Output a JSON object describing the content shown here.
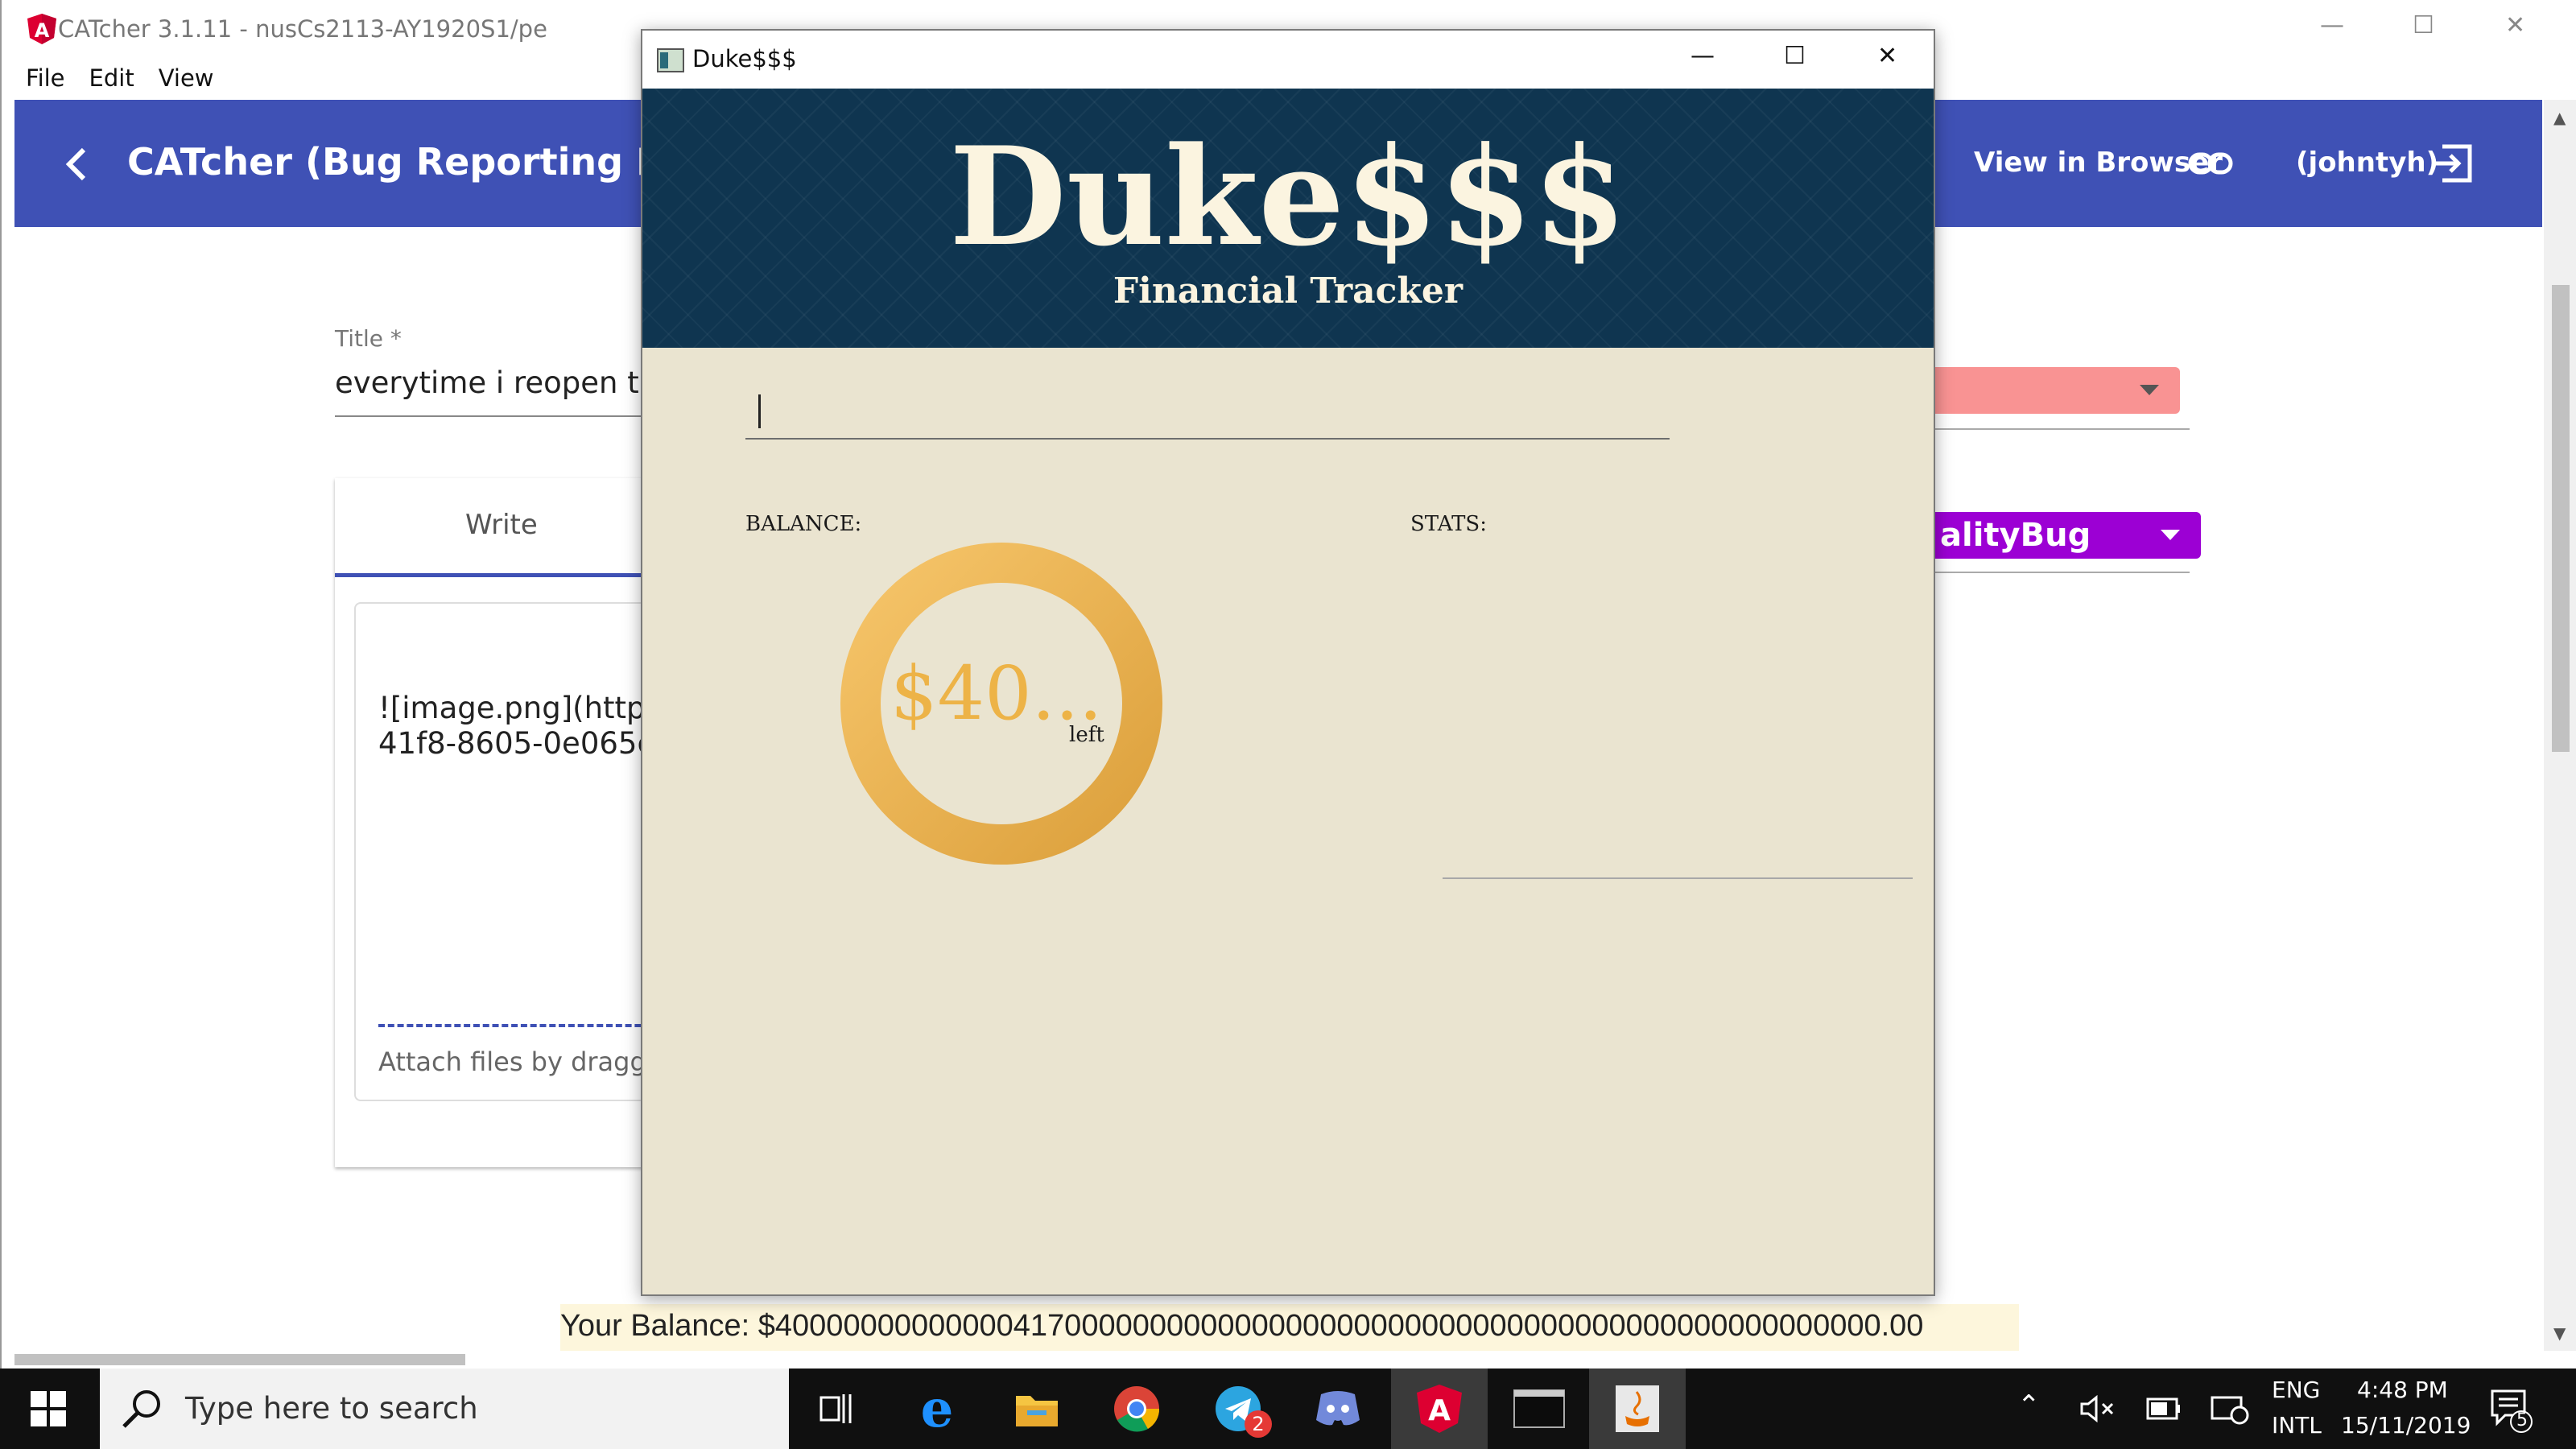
{
  "catcher": {
    "window_title": "CATcher 3.1.11 - nusCs2113-AY1920S1/pe",
    "menu": [
      "File",
      "Edit",
      "View"
    ],
    "toolbar_title": "CATcher  (Bug Reporting Phase)",
    "view_in_browser": "View in Browser",
    "user": "(johntyh)",
    "title_label": "Title *",
    "title_value": "everytime i reopen the",
    "tab_write": "Write",
    "body_text_line1": "![image.png](https:",
    "body_text_line2": "41f8-8605-0e065c",
    "attach_hint": "Attach files by dragging",
    "type_dropdown_value": "FunctionalityBug",
    "type_dropdown_visible": "alityBug",
    "severity_color": "#f99393",
    "type_color": "#9c00d4",
    "accent": "#3f51b5"
  },
  "duke": {
    "window_title": "Duke$$$",
    "app_title": "Duke$$$",
    "subtitle": "Financial Tracker",
    "input_value": "",
    "balance_label": "BALANCE:",
    "stats_label": "STATS:",
    "ring_amount": "$40...",
    "ring_suffix": "left",
    "ring_color": "#e8ac44",
    "status_line": "Your Balance: $40000000000000417000000000000000000000000000000000000000000000000.00"
  },
  "taskbar": {
    "search_placeholder": "Type here to search",
    "telegram_badge": "2",
    "language_top": "ENG",
    "language_bottom": "INTL",
    "time": "4:48 PM",
    "date": "15/11/2019",
    "notification_count": "5"
  }
}
